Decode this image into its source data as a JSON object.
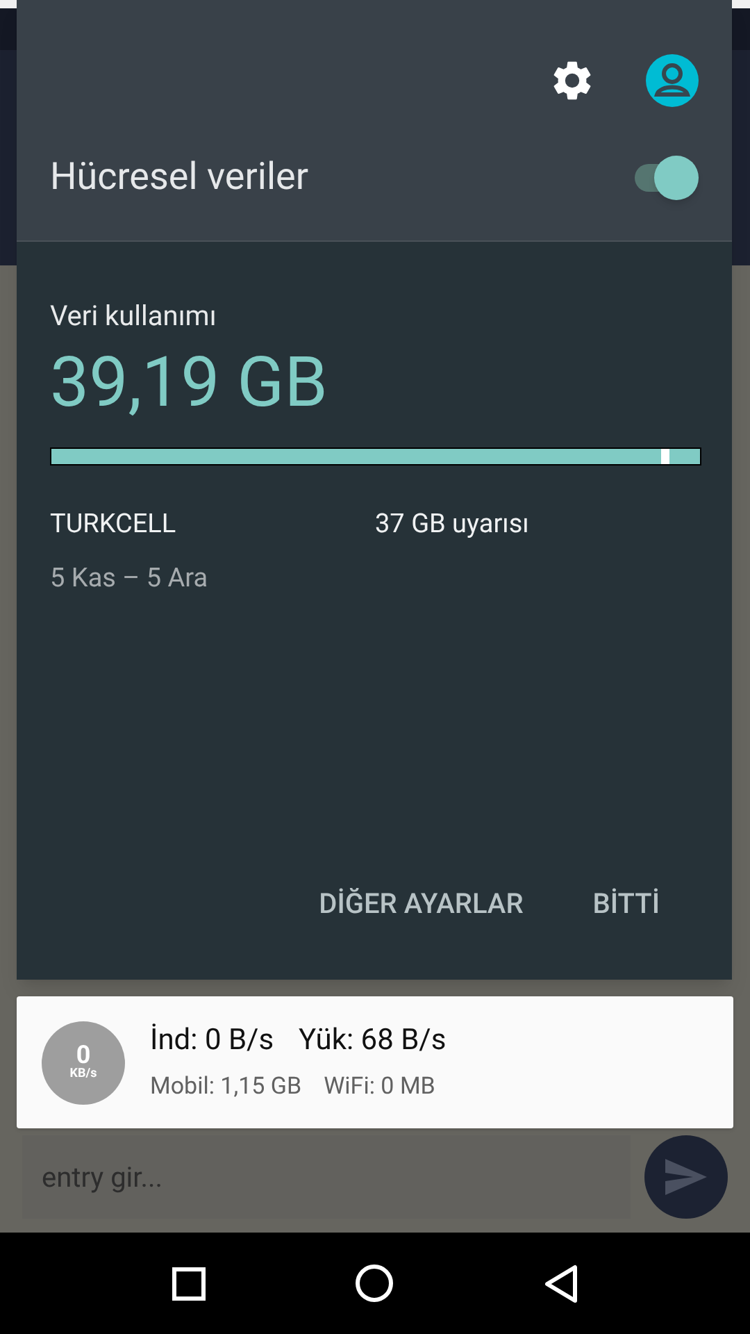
{
  "background_app": {
    "entry": {
      "placeholder": "entry gir..."
    }
  },
  "quick_settings": {
    "title": "Hücresel veriler",
    "on": true
  },
  "data_usage": {
    "label": "Veri kullanımı",
    "amount": "39,19 GB",
    "level": 1,
    "carrier": "TURKCELL",
    "period": "5 Kas – 5 Ara",
    "warning": "37 GB uyarısı"
  },
  "actions": [
    "DİĞER AYARLAR",
    "BİTTİ"
  ],
  "notification": {
    "badge_value": "0",
    "badge_unit": "KB/s",
    "speeds": [
      "İnd: 0 B/s",
      "Yük: 68 B/s"
    ],
    "totals": [
      "Mobil: 1,15 GB",
      "WiFi: 0 MB"
    ]
  }
}
